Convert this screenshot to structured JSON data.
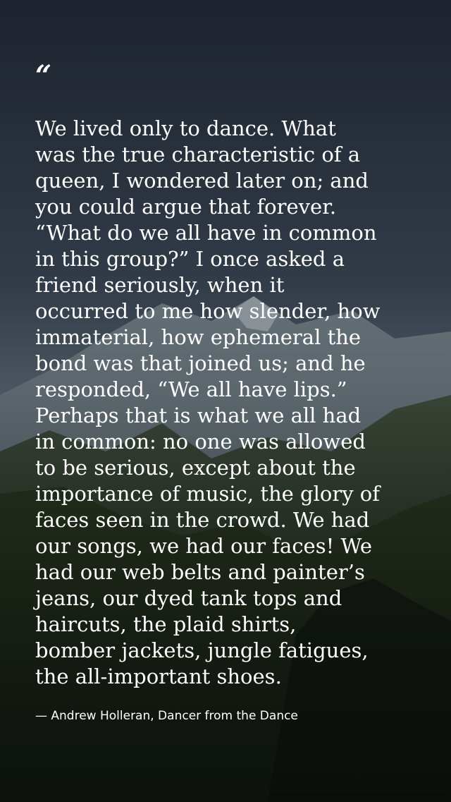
{
  "quote": {
    "mark": "“",
    "text": "We lived only to dance. What\nwas the true characteristic of a\nqueen, I wondered later on; and\nyou could argue that forever.\n“What do we all have in common\nin this group?” I once asked a\nfriend seriously, when it\noccurred to me how slender, how\nimmaterial, how ephemeral the\nbond was that joined us; and he\nresponded, “We all have lips.”\nPerhaps that is what we all had\nin common: no one was allowed\nto be serious, except about the\nimportance of music, the glory of\nfaces seen in the crowd. We had\nour songs, we had our faces! We\nhad our web belts and painter’s\njeans, our dyed tank tops and\nhaircuts, the plaid shirts,\nbomber jackets, jungle fatigues,\nthe all-important shoes.",
    "attribution": "— Andrew Holleran, Dancer from the Dance"
  },
  "colors": {
    "sky_top": "#2a3342",
    "sky_bottom": "#5d6b78",
    "mountain_far": "#6f7d86",
    "mountain_mid": "#2f3b2e",
    "mountain_near": "#1e2a1f",
    "text": "#ffffff"
  }
}
